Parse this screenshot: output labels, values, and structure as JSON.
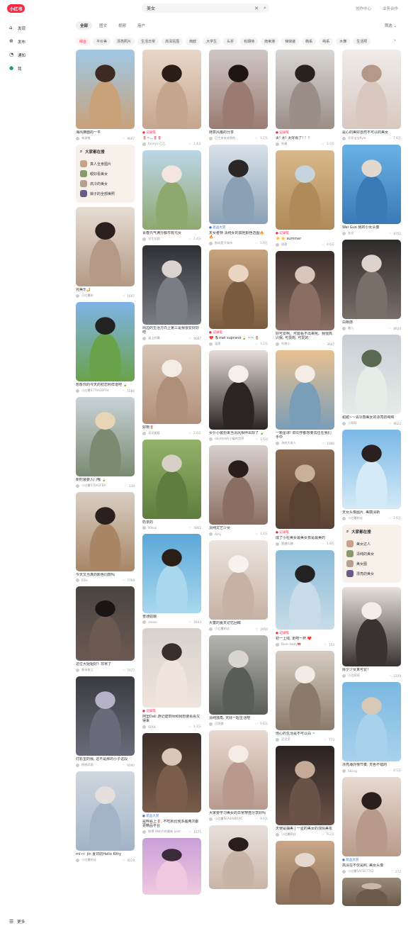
{
  "header": {
    "logo": "小红书",
    "search_query": "美女",
    "search_icon": "search-icon",
    "clear_icon": "close-icon",
    "links": [
      "创作中心",
      "业务合作"
    ]
  },
  "sidebar": {
    "items": [
      {
        "label": "发现",
        "icon": "home-icon"
      },
      {
        "label": "发布",
        "icon": "plus-icon"
      },
      {
        "label": "通知",
        "icon": "bell-icon"
      },
      {
        "label": "我",
        "icon": "user-icon"
      }
    ],
    "more": "更多"
  },
  "tabs": [
    "全部",
    "图文",
    "视频",
    "用户"
  ],
  "filter_label": "筛选",
  "chips": [
    "综合",
    "平价美",
    "漂亮照片",
    "生活日常",
    "高清氛围",
    "南欧",
    "大学生",
    "头折",
    "有期待",
    "南柬港",
    "辣妹装",
    "韩系",
    "纯系",
    "木舞",
    "生活照"
  ],
  "colors": {
    "accent": "#ff2442",
    "related_bg": "#f7f1ea"
  },
  "columns": [
    {
      "cards": [
        {
          "kind": "post",
          "title": "海风拂面的一平",
          "author": "来源笔",
          "likes": "9607",
          "img_h": 112,
          "colors": [
            "#9fc8e6",
            "#c9a27a",
            "#3d2a22"
          ]
        },
        {
          "kind": "related",
          "heading": "大家都在搜",
          "items": [
            "真人全身图片",
            "眼好看美女",
            "高冷的美女",
            "娘子的全部美照"
          ]
        },
        {
          "kind": "post",
          "title": "完美乐🤳",
          "author": "小红薯粉",
          "likes": "1607",
          "img_h": 112,
          "colors": [
            "#e7ddd4",
            "#b49a86",
            "#2a1f1c"
          ]
        },
        {
          "kind": "post",
          "title": "想象你的今天的初恋照样谱吧 🍃",
          "author": "小红薯6779430FF4",
          "likes": "1086",
          "img_h": 112,
          "colors": [
            "#7fb3e8",
            "#6aa24a",
            "#222"
          ]
        },
        {
          "kind": "post",
          "title": "新时装要入门哦 🍃",
          "author": "小红薯570A2FBA",
          "likes": "138",
          "img_h": 112,
          "colors": [
            "#c9d3d8",
            "#7a8b72",
            "#e8d5b5"
          ]
        },
        {
          "kind": "post",
          "title": "今天又当真的颜色同款吗",
          "author": "Ellie",
          "likes": "7709",
          "img_h": 112,
          "colors": [
            "#d9cfc4",
            "#a88666",
            "#2b2020"
          ]
        },
        {
          "kind": "post",
          "title": "这位大姐姐好？非常了",
          "author": "春半夜之",
          "likes": "7477",
          "img_h": 105,
          "colors": [
            "#4a4440",
            "#6b5a52",
            "#1a1515"
          ]
        },
        {
          "kind": "post",
          "title": "灯影里的我, 这不是那的小子这段",
          "author": "桃桃萌萌",
          "likes": "6090",
          "img_h": 112,
          "colors": [
            "#3a3b40",
            "#6a6b7a",
            "#b6b3c8"
          ]
        },
        {
          "kind": "post",
          "title": "mi 👀 jin 夏日的Hello Kitty",
          "author": "小红薯粉丝",
          "likes": "6029",
          "img_h": 112,
          "colors": [
            "#cfd7df",
            "#a3b4c8",
            "#e5e0dc"
          ]
        }
      ]
    },
    {
      "cards": [
        {
          "kind": "post",
          "tag": "记录笔",
          "title": "🌷~...🌷🌷",
          "author": "funny小乙乙",
          "likes": "1.4万",
          "img_h": 112,
          "colors": [
            "#e9d7c9",
            "#c5a58c",
            "#2a1d18"
          ]
        },
        {
          "kind": "post",
          "title": "青春元气满分都市有元女",
          "author": "学生党超",
          "likes": "1.4万",
          "img_h": 112,
          "colors": [
            "#bcd6e8",
            "#8fa86e",
            "#f2e6df"
          ]
        },
        {
          "kind": "post",
          "title": "周边的生活方向上第三是我很爱好好吧",
          "author": "桌上的幕",
          "likes": "9087",
          "img_h": 112,
          "colors": [
            "#2e3034",
            "#7a7d83",
            "#d8d3cf"
          ]
        },
        {
          "kind": "post",
          "title": "好物🌷",
          "author": "深深美媛",
          "likes": "2.6万",
          "img_h": 112,
          "colors": [
            "#d8c5b5",
            "#b08f78",
            "#f4ede6"
          ]
        },
        {
          "kind": "post",
          "title": "奶茶的",
          "author": "Mitsui",
          "likes": "5862",
          "img_h": 112,
          "colors": [
            "#93b36a",
            "#5e7d3e",
            "#d8d0c6"
          ]
        },
        {
          "kind": "post",
          "title": "普通姑娘",
          "author": "deleio",
          "likes": "5933",
          "img_h": 112,
          "colors": [
            "#5ba8d8",
            "#a9d8ee",
            "#2b1e18"
          ]
        },
        {
          "kind": "post",
          "tag": "记录笔",
          "title": "阿里Dali 游记建筑师和我想要看看又得来",
          "author": "SOUL",
          "likes": "1.2万",
          "img_h": 112,
          "colors": [
            "#d8d2cc",
            "#f0e4dc",
            "#3a2e2a"
          ]
        },
        {
          "kind": "post",
          "tag": "新品大赏",
          "tag_blue": true,
          "title": "是啊看上🌷, 不吃就比我多画两次都更精品平台",
          "author": "微博 Watch的最新 post",
          "likes": "1571",
          "img_h": 112,
          "colors": [
            "#3a2e28",
            "#7a5d4a",
            "#d9c6b6"
          ]
        },
        {
          "kind": "post",
          "title": "",
          "author": "",
          "likes": "",
          "img_h": 80,
          "colors": [
            "#c8a0d8",
            "#f0c8e0",
            "#3a2a3a"
          ]
        }
      ]
    },
    {
      "cards": [
        {
          "kind": "post",
          "title": "随意风格的分享",
          "author": "后生来来成朋的",
          "likes": "1.2万",
          "img_h": 112,
          "colors": [
            "#cfc7c5",
            "#9a7b72",
            "#1f1614"
          ]
        },
        {
          "kind": "post",
          "tag": "新品大赏",
          "tag_blue": true,
          "title": "天女者特 清纯女的其他颜色选图🔥🔥",
          "author": "数码是大城市",
          "likes": "5.9万",
          "img_h": 112,
          "colors": [
            "#d9e2ea",
            "#8aa0b4",
            "#2a2626"
          ]
        },
        {
          "kind": "post",
          "tag": "记录笔",
          "title": "❤️ 🐧mel suprano 🍃 ~~ 🌷",
          "author": "温柔",
          "likes": "1.2万",
          "img_h": 112,
          "colors": [
            "#c8a47e",
            "#7a5a3e",
            "#e8d6c2"
          ]
        },
        {
          "kind": "post",
          "title": "女仆小装扮来当清风相伴出现了 🍃",
          "author": "obetten的小编的世界",
          "likes": "1710",
          "img_h": 112,
          "colors": [
            "#e6dcd6",
            "#2b2424",
            "#f5f0ec"
          ]
        },
        {
          "kind": "post",
          "title": "清纯文艺少女",
          "author": "Amy",
          "likes": "1.2万",
          "img_h": 112,
          "colors": [
            "#d8d0cc",
            "#8a6e62",
            "#2a1c1a"
          ]
        },
        {
          "kind": "post",
          "title": "大童的夏天记忆回眸",
          "author": "小红薯粉丝",
          "likes": "2950",
          "img_h": 112,
          "colors": [
            "#ece4de",
            "#c6b1a4",
            "#f7f2ee"
          ]
        },
        {
          "kind": "post",
          "title": "清纯独角, 天际一起生活吧",
          "author": "日照美",
          "likes": "9.6万",
          "img_h": 112,
          "colors": [
            "#b5b6b2",
            "#5a5c58",
            "#d9d5d0"
          ]
        },
        {
          "kind": "post",
          "title": "大家要学习美女的日常穿搭分享好吗",
          "author": "小红薯5EA4A8BFAC",
          "likes": "9.1万",
          "img_h": 112,
          "colors": [
            "#e8dad2",
            "#b89a8c",
            "#f5ece6"
          ]
        },
        {
          "kind": "post",
          "title": "",
          "author": "",
          "likes": "",
          "img_h": 90,
          "colors": [
            "#e8e0da",
            "#c9b5a8",
            "#2a1e1a"
          ]
        }
      ]
    },
    {
      "cards": [
        {
          "kind": "post",
          "tag": "记录笔",
          "title": "太! 太! 太好看了! ！！",
          "author": "秋酱",
          "likes": "2.3万",
          "img_h": 112,
          "colors": [
            "#d8d6d4",
            "#9a8e86",
            "#2a2020"
          ]
        },
        {
          "kind": "post",
          "tag": "记录笔",
          "title": "☀️ ☀️ summer",
          "author": "甜甜",
          "likes": "4.6万",
          "img_h": 112,
          "colors": [
            "#d8b88a",
            "#b08a58",
            "#c6d4de"
          ]
        },
        {
          "kind": "post",
          "title": "好可爱啊。可能看不出来呢。我很高兴我, 可爱的, 可爱的",
          "author": "刘晓小",
          "likes": "3647",
          "img_h": 112,
          "colors": [
            "#3a2e2a",
            "#8a6e62",
            "#d6c6bc"
          ]
        },
        {
          "kind": "post",
          "title": "一颗星球! 旧同学都想要去往在我们手中",
          "author": "海底大佬人",
          "likes": "1086",
          "img_h": 112,
          "colors": [
            "#e8c090",
            "#7a9eb8",
            "#f4ede6"
          ]
        },
        {
          "kind": "post",
          "tag": "记录笔",
          "title": "成了小社美女最美女孩是最美的",
          "author": "蜜糖丸糖",
          "likes": "1.8万",
          "img_h": 112,
          "colors": [
            "#8a6a52",
            "#5a4232",
            "#c8b09a"
          ]
        },
        {
          "kind": "post",
          "tag": "记录笔",
          "title": "初一上线, 走吧一杯 ❤️",
          "author": "Bean Baby🎀",
          "likes": "153",
          "img_h": 112,
          "colors": [
            "#8abcd8",
            "#c8dce8",
            "#222"
          ]
        },
        {
          "kind": "post",
          "title": "他心的生活是不可以白 ~",
          "author": "泥泥泥",
          "likes": "773",
          "img_h": 112,
          "colors": [
            "#d6ccc2",
            "#8a7a6a",
            "#f2ece6"
          ]
        },
        {
          "kind": "post",
          "title": "天使是抽美 | 一星的美女的浓情美妆",
          "author": "小红薯粉丝",
          "likes": "9.2万",
          "img_h": 112,
          "colors": [
            "#2a2220",
            "#6a5248",
            "#c6aa98"
          ]
        },
        {
          "kind": "post",
          "title": "",
          "author": "",
          "likes": "",
          "img_h": 90,
          "colors": [
            "#c8a888",
            "#8a6e58",
            "#e6d8cc"
          ]
        }
      ]
    },
    {
      "cards": [
        {
          "kind": "post",
          "title": "是心的美好自然不可以的美女",
          "author": "珍珍宝宝Kyla",
          "likes": "7.6万",
          "img_h": 112,
          "colors": [
            "#f0ece8",
            "#d8c8c0",
            "#b4988a"
          ]
        },
        {
          "kind": "post",
          "title": "Wei Guo 我的小女头像",
          "author": "女艺",
          "likes": "8752",
          "img_h": 112,
          "colors": [
            "#6ab2e6",
            "#3a7ab6",
            "#e2d8ce"
          ]
        },
        {
          "kind": "post",
          "title": "白晰感",
          "author": "春儿",
          "likes": "8920",
          "img_h": 112,
          "colors": [
            "#2e2a2a",
            "#7a6e68",
            "#dcd2ca"
          ]
        },
        {
          "kind": "post",
          "title": "甜甜~~清冷感美女的漂亮的纯纯",
          "author": "小萌萌",
          "likes": "9622",
          "img_h": 112,
          "colors": [
            "#c8ced4",
            "#e6ece8",
            "#5a6a52"
          ]
        },
        {
          "kind": "post",
          "title": "天女头像图片, 美丽清新",
          "author": "小红薯粉丝",
          "likes": "2.6万",
          "img_h": 112,
          "colors": [
            "#7ab8e8",
            "#d4eaf6",
            "#2a2020"
          ]
        },
        {
          "kind": "related",
          "heading": "大家都在搜",
          "items": [
            "美女达人",
            "清纯的美女",
            "美女图",
            "漂亮的美女"
          ]
        },
        {
          "kind": "post",
          "title": "除夕少女真可爱！",
          "author": "小红萌萌",
          "likes": "2229",
          "img_h": 112,
          "colors": [
            "#e8e0da",
            "#3a3232",
            "#f4eeea"
          ]
        },
        {
          "kind": "post",
          "title": "漂亮海外慢节奏, 天色不错的",
          "author": "Skling",
          "likes": "8.5万",
          "img_h": 112,
          "colors": [
            "#7ab8e0",
            "#a8d2ec",
            "#d8c8b8"
          ]
        },
        {
          "kind": "post",
          "tag": "新品大赏",
          "tag_blue": true,
          "title": "高清在不仅是照, 美女头像",
          "author": "小红薯5AFEE7742",
          "likes": "272",
          "img_h": 112,
          "colors": [
            "#e8dad2",
            "#b89a8a",
            "#2a1e1a"
          ]
        },
        {
          "kind": "post",
          "title": "",
          "author": "",
          "likes": "",
          "img_h": 40,
          "colors": [
            "#9a8a7a",
            "#6a5a4a",
            "#c8b8a8"
          ]
        }
      ]
    }
  ]
}
